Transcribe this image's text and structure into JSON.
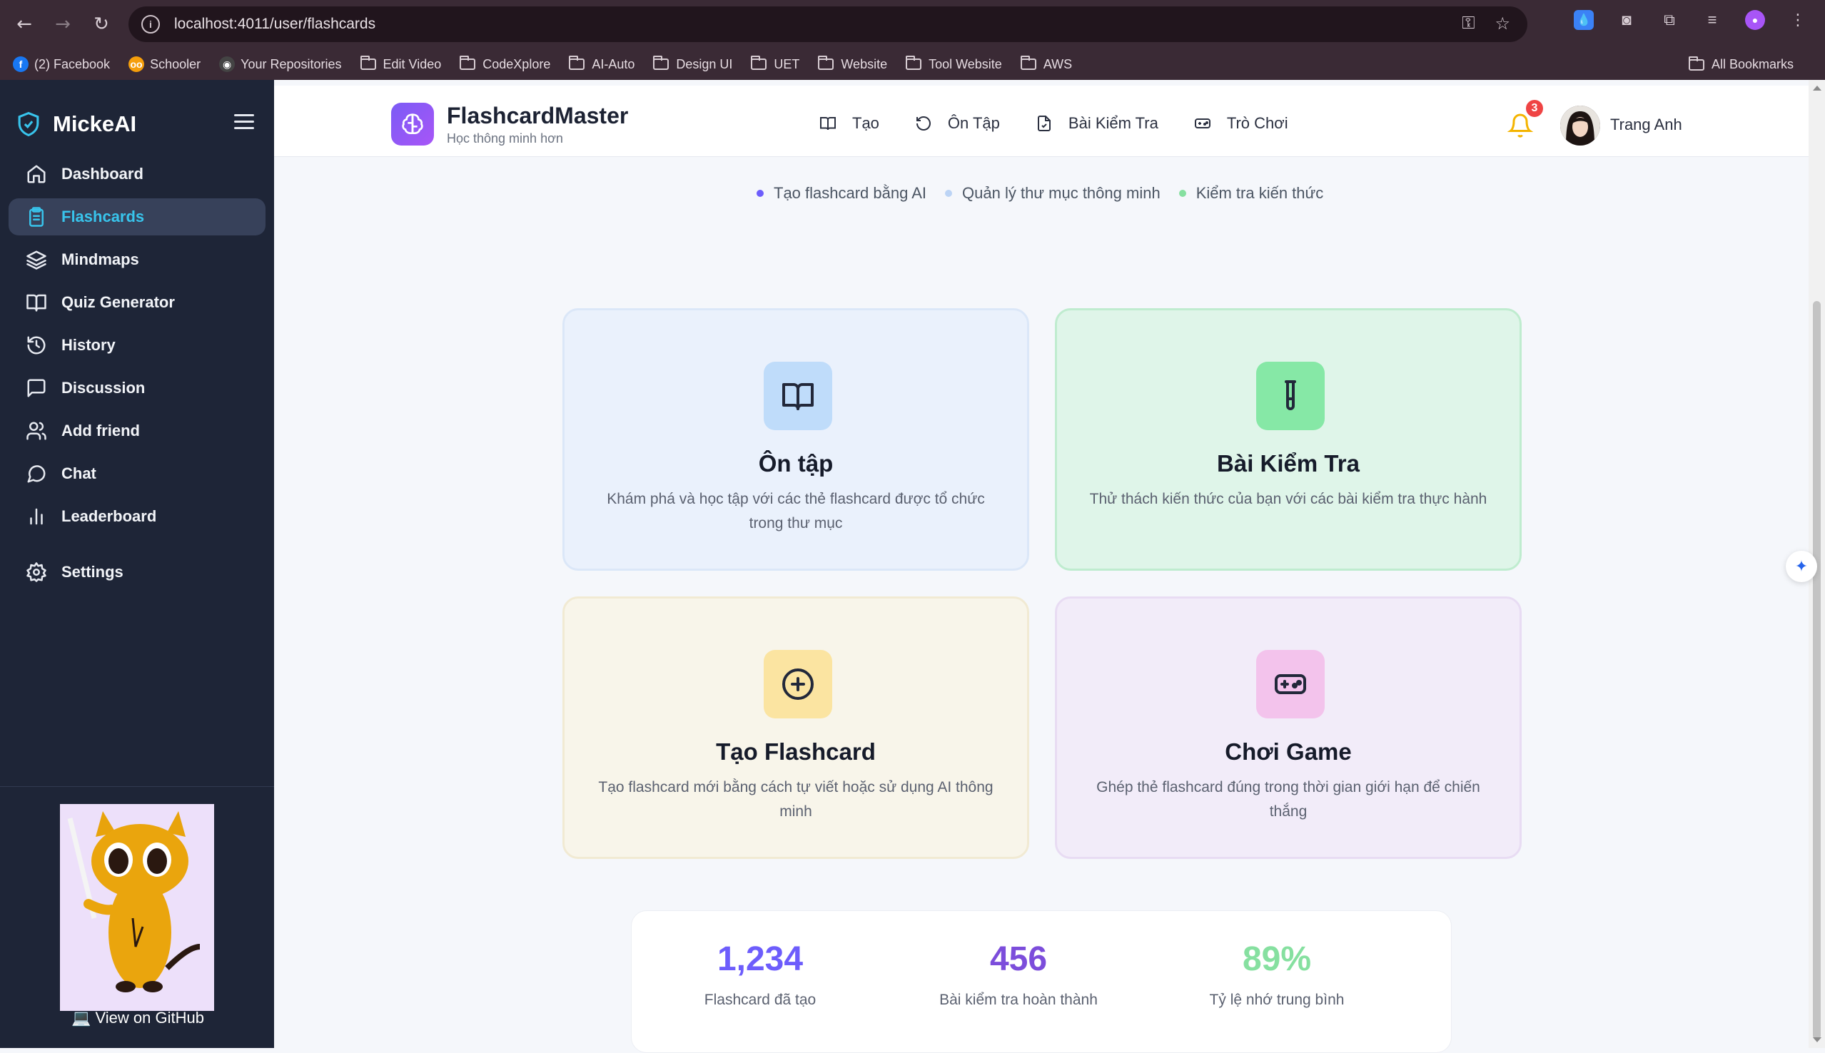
{
  "browser": {
    "url": "localhost:4011/user/flashcards",
    "bookmarks": [
      {
        "label": "(2) Facebook",
        "type": "favicon",
        "color": "#1877f2",
        "glyph": "f"
      },
      {
        "label": "Schooler",
        "type": "favicon",
        "color": "#f59e0b",
        "glyph": "oo"
      },
      {
        "label": "Your Repositories",
        "type": "favicon",
        "color": "#444",
        "glyph": "◉"
      },
      {
        "label": "Edit Video",
        "type": "folder"
      },
      {
        "label": "CodeXplore",
        "type": "folder"
      },
      {
        "label": "AI-Auto",
        "type": "folder"
      },
      {
        "label": "Design UI",
        "type": "folder"
      },
      {
        "label": "UET",
        "type": "folder"
      },
      {
        "label": "Website",
        "type": "folder"
      },
      {
        "label": "Tool Website",
        "type": "folder"
      },
      {
        "label": "AWS",
        "type": "folder"
      }
    ],
    "all_bookmarks": "All Bookmarks"
  },
  "sidebar": {
    "brand": "MickeAI",
    "items": [
      {
        "label": "Dashboard",
        "icon": "home-icon"
      },
      {
        "label": "Flashcards",
        "icon": "clipboard-icon",
        "active": true
      },
      {
        "label": "Mindmaps",
        "icon": "layers-icon"
      },
      {
        "label": "Quiz Generator",
        "icon": "book-open-icon"
      },
      {
        "label": "History",
        "icon": "history-icon"
      },
      {
        "label": "Discussion",
        "icon": "message-square-icon"
      },
      {
        "label": "Add friend",
        "icon": "users-icon"
      },
      {
        "label": "Chat",
        "icon": "message-circle-icon"
      },
      {
        "label": "Leaderboard",
        "icon": "bar-chart-icon"
      },
      {
        "label": "Settings",
        "icon": "gear-icon"
      }
    ],
    "github_link": "💻 View on GitHub"
  },
  "topbar": {
    "title": "FlashcardMaster",
    "subtitle": "Học thông minh hơn",
    "nav": [
      {
        "label": "Tạo",
        "icon": "book-icon"
      },
      {
        "label": "Ôn Tập",
        "icon": "rotate-icon"
      },
      {
        "label": "Bài Kiểm Tra",
        "icon": "file-check-icon"
      },
      {
        "label": "Trò Chơi",
        "icon": "gamepad-icon"
      }
    ],
    "notification_count": "3",
    "username": "Trang Anh"
  },
  "features": [
    {
      "label": "Tạo flashcard bằng AI",
      "color": "#6d5dfc"
    },
    {
      "label": "Quản lý thư mục thông minh",
      "color": "#bcd4f5"
    },
    {
      "label": "Kiểm tra kiến thức",
      "color": "#86e0a0"
    }
  ],
  "cards": [
    {
      "title": "Ôn tập",
      "desc": "Khám phá và học tập với các thẻ flashcard được tổ chức trong thư mục",
      "icon": "book-open-icon",
      "bg": "#eaf1fc",
      "border": "#dbe7f8",
      "icon_bg": "#bfdcfa"
    },
    {
      "title": "Bài Kiểm Tra",
      "desc": "Thử thách kiến thức của bạn với các bài kiểm tra thực hành",
      "icon": "test-tube-icon",
      "bg": "#dff5e9",
      "border": "#bfeccf",
      "icon_bg": "#86e8a6"
    },
    {
      "title": "Tạo Flashcard",
      "desc": "Tạo flashcard mới bằng cách tự viết hoặc sử dụng AI thông minh",
      "icon": "plus-circle-icon",
      "bg": "#f8f5ea",
      "border": "#f1ead3",
      "icon_bg": "#fbe4a1"
    },
    {
      "title": "Chơi Game",
      "desc": "Ghép thẻ flashcard đúng trong thời gian giới hạn để chiến thắng",
      "icon": "gamepad-icon",
      "bg": "#f2ecf9",
      "border": "#e8dcf3",
      "icon_bg": "#f3c3ec"
    }
  ],
  "stats": [
    {
      "value": "1,234",
      "label": "Flashcard đã tạo",
      "color": "#6d5dfc"
    },
    {
      "value": "456",
      "label": "Bài kiểm tra hoàn thành",
      "color": "#7c4ddb"
    },
    {
      "value": "89%",
      "label": "Tỷ lệ nhớ trung bình",
      "color": "#86e0a0"
    }
  ]
}
